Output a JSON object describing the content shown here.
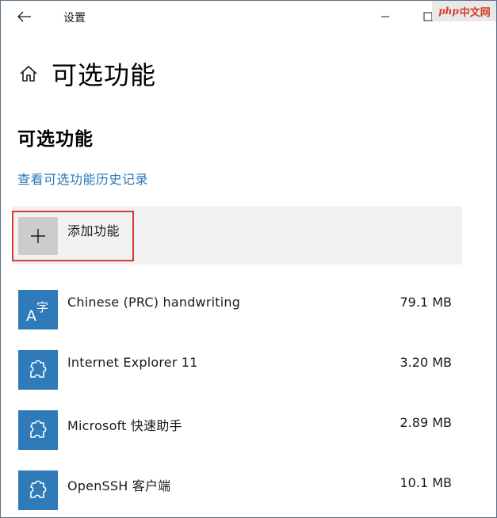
{
  "watermark": {
    "en": "php",
    "cn": "中文网"
  },
  "titlebar": {
    "title": "设置"
  },
  "header": {
    "title": "可选功能"
  },
  "section": {
    "title": "可选功能"
  },
  "history_link": {
    "label": "查看可选功能历史记录"
  },
  "add_feature": {
    "label": "添加功能"
  },
  "features": [
    {
      "name": "Chinese (PRC) handwriting",
      "size": "79.1 MB",
      "icon": "language-icon"
    },
    {
      "name": "Internet Explorer 11",
      "size": "3.20 MB",
      "icon": "puzzle-icon"
    },
    {
      "name": "Microsoft 快速助手",
      "size": "2.89 MB",
      "icon": "puzzle-icon"
    },
    {
      "name": "OpenSSH 客户端",
      "size": "10.1 MB",
      "icon": "puzzle-icon"
    }
  ],
  "colors": {
    "accent": "#2f7ab8",
    "link": "#2b78b5",
    "highlight": "#d63a3a",
    "add_area_bg": "#f2f2f2",
    "add_icon_bg": "#cccccc"
  }
}
